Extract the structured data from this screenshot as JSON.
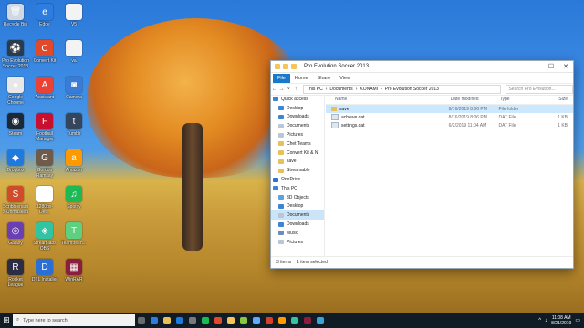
{
  "desktop": {
    "icons": [
      {
        "label": "Recycle Bin",
        "color": "#cfd8e3",
        "glyph": "🗑"
      },
      {
        "label": "Pro Evolution Soccer 2013",
        "color": "#2a3b4e",
        "glyph": "⚽"
      },
      {
        "label": "Google Chrome",
        "color": "#e8e8e8",
        "glyph": "●"
      },
      {
        "label": "Steam",
        "color": "#1b2838",
        "glyph": "◉"
      },
      {
        "label": "Dropbox",
        "color": "#1f7ae0",
        "glyph": "◆"
      },
      {
        "label": "Scribblenauts Unmasked",
        "color": "#d14a2a",
        "glyph": "S"
      },
      {
        "label": "Galaxy",
        "color": "#6a3fb2",
        "glyph": "◎"
      },
      {
        "label": "Rocket League",
        "color": "#2c2c44",
        "glyph": "R"
      },
      {
        "label": "Edge",
        "color": "#2d7de0",
        "glyph": "e"
      },
      {
        "label": "Convert Kit",
        "color": "#e04a2a",
        "glyph": "C"
      },
      {
        "label": "Assistant",
        "color": "#ea4335",
        "glyph": "A"
      },
      {
        "label": "Football Manager",
        "color": "#c8102e",
        "glyph": "F"
      },
      {
        "label": "Gordon Ramsay",
        "color": "#6e5b4c",
        "glyph": "G"
      },
      {
        "label": "1280px-Det...",
        "color": "#ffffff",
        "glyph": ""
      },
      {
        "label": "Streamlabs OBS",
        "color": "#31c3a2",
        "glyph": "◈"
      },
      {
        "label": "DTL Installer",
        "color": "#2a6fd6",
        "glyph": "D"
      },
      {
        "label": "V5",
        "color": "#f3f3f3",
        "glyph": ""
      },
      {
        "label": "va",
        "color": "#f3f3f3",
        "glyph": ""
      },
      {
        "label": "Camera",
        "color": "#3a7bd5",
        "glyph": "◙"
      },
      {
        "label": "Tumblr",
        "color": "#35465c",
        "glyph": "t"
      },
      {
        "label": "Amazon",
        "color": "#ff9900",
        "glyph": "a"
      },
      {
        "label": "Spotify",
        "color": "#1db954",
        "glyph": "♫"
      },
      {
        "label": "Teamtreeh...",
        "color": "#5fcf80",
        "glyph": "T"
      },
      {
        "label": "WinRAR",
        "color": "#8b1e3f",
        "glyph": "▦"
      }
    ]
  },
  "explorer": {
    "title": "Pro Evolution Soccer 2013",
    "ribbon_tabs": [
      "File",
      "Home",
      "Share",
      "View"
    ],
    "breadcrumb": [
      "This PC",
      "Documents",
      "KONAMI",
      "Pro Evolution Soccer 2013"
    ],
    "search_placeholder": "Search Pro Evolution...",
    "nav_items": [
      {
        "label": "Quick access",
        "head": true,
        "color": "#3b86d4"
      },
      {
        "label": "Desktop",
        "head": false,
        "color": "#3b86d4"
      },
      {
        "label": "Downloads",
        "head": false,
        "color": "#3b86d4"
      },
      {
        "label": "Documents",
        "head": false,
        "color": "#b9c6d6"
      },
      {
        "label": "Pictures",
        "head": false,
        "color": "#b9c6d6"
      },
      {
        "label": "Chet Teams",
        "head": false,
        "color": "#e8c05a"
      },
      {
        "label": "Convert Kit & N",
        "head": false,
        "color": "#e8c05a"
      },
      {
        "label": "save",
        "head": false,
        "color": "#e8c05a"
      },
      {
        "label": "Streamable",
        "head": false,
        "color": "#e8c05a"
      },
      {
        "label": "OneDrive",
        "head": true,
        "color": "#2b73d3"
      },
      {
        "label": "This PC",
        "head": true,
        "color": "#3b86d4"
      },
      {
        "label": "3D Objects",
        "head": false,
        "color": "#5ba3dd"
      },
      {
        "label": "Desktop",
        "head": false,
        "color": "#3b86d4"
      },
      {
        "label": "Documents",
        "head": false,
        "color": "#b9c6d6",
        "selected": true
      },
      {
        "label": "Downloads",
        "head": false,
        "color": "#3b86d4"
      },
      {
        "label": "Music",
        "head": false,
        "color": "#6a8cc2"
      },
      {
        "label": "Pictures",
        "head": false,
        "color": "#b9c6d6"
      }
    ],
    "columns": {
      "name": "Name",
      "date": "Date modified",
      "type": "Type",
      "size": "Size"
    },
    "files": [
      {
        "name": "save",
        "date": "8/16/2019 8:06 PM",
        "type": "File folder",
        "size": "",
        "folder": true,
        "selected": true
      },
      {
        "name": "achieve.dat",
        "date": "8/16/2019 8:06 PM",
        "type": "DAT File",
        "size": "1 KB",
        "folder": false
      },
      {
        "name": "settings.dat",
        "date": "6/2/2019 11:04 AM",
        "type": "DAT File",
        "size": "1 KB",
        "folder": false
      }
    ],
    "status": {
      "count": "3 items",
      "selected": "1 item selected"
    }
  },
  "taskbar": {
    "search_text": "Type here to search",
    "apps": [
      "#6a6a6a",
      "#2d7de0",
      "#e8c05a",
      "#1f7ae0",
      "#7a7a7a",
      "#1db954",
      "#e04a2a",
      "#f3c55b",
      "#8ac53f",
      "#5fa9ff",
      "#d6402b",
      "#ff9900",
      "#31c3a2",
      "#8b1e3f",
      "#3aa3d8"
    ],
    "time": "11:08 AM",
    "date": "8/21/2019"
  }
}
